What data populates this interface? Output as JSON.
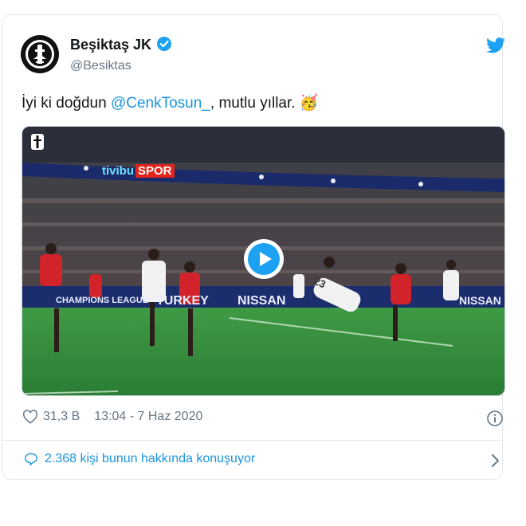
{
  "account": {
    "display_name": "Beşiktaş JK",
    "handle": "@Besiktas",
    "avatar_icon": "besiktas-eagle-logo",
    "verified_icon": "verified-badge-icon",
    "brand_icon": "twitter-bird-icon"
  },
  "tweet": {
    "text_before": "İyi ki doğdun ",
    "mention": "@CenkTosun_",
    "text_after": ", mutlu yıllar. ",
    "emoji": "🥳"
  },
  "media": {
    "type": "video",
    "play_icon": "play-icon",
    "corner_logo_icon": "besiktas-eagle-logo",
    "broadcaster_logo": "tivibu",
    "broadcaster_logo_suffix": "SPOR",
    "board_left": "CHAMPIONS LEAGUE",
    "board_mid": "TURKEY",
    "board_right": "NISSAN",
    "board_right2": "NISSAN",
    "player_number": "23"
  },
  "stats": {
    "likes": "31,3 B",
    "timestamp": "13:04 - 7 Haz 2020",
    "like_icon": "heart-icon",
    "info_icon": "info-icon"
  },
  "conversation": {
    "label": "2.368 kişi bunun hakkında konuşuyor",
    "icon": "speech-bubble-icon",
    "chevron_icon": "chevron-right-icon"
  },
  "colors": {
    "link": "#1b95e0",
    "muted": "#657786",
    "pitch": "#2f8a3a",
    "jersey_red": "#d2232a"
  }
}
